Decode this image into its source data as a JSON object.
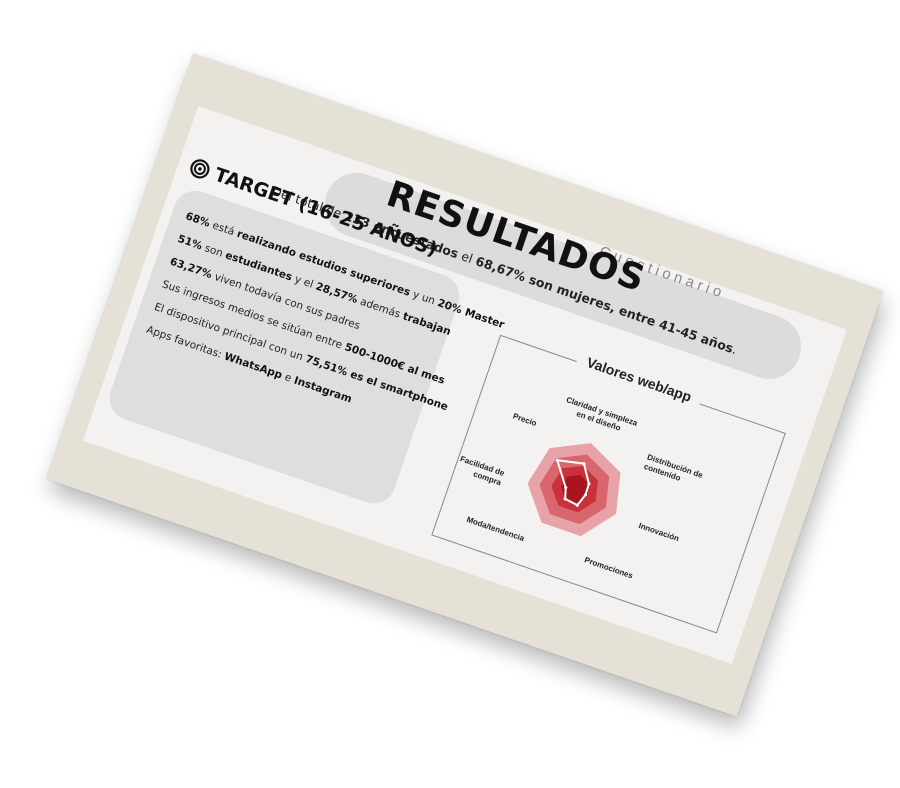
{
  "header": {
    "subtitle": "Cuestionario",
    "title": "RESULTADOS",
    "summary": {
      "t1": "Del total de ",
      "b1": "233 encuestados",
      "t2": " el ",
      "b2": "68,67% son mujeres, entre 41-45 años",
      "t3": "."
    }
  },
  "target": {
    "heading": "TARGET (16-25 AÑOS)",
    "icon": "target-icon",
    "items": [
      {
        "b1": "68%",
        "t1": " está ",
        "b2": "realizando estudios superiores",
        "t2": " y un ",
        "b3": "20% Master",
        "t3": ""
      },
      {
        "b1": "51%",
        "t1": " son ",
        "b2": "estudiantes",
        "t2": " y el ",
        "b3": "28,57%",
        "t3": " además ",
        "b4": "trabajan"
      },
      {
        "b1": "63,27%",
        "t1": " viven todavía con sus padres"
      },
      {
        "t1": "Sus ingresos medios se sitúan entre ",
        "b1": "500-1000€ al mes"
      },
      {
        "t1": "El dispositivo principal con un ",
        "b1": "75,51% es el smartphone"
      },
      {
        "t1": "Apps favoritas: ",
        "b1": "WhatsApp",
        "t2": " e ",
        "b2": "Instagram"
      }
    ]
  },
  "chart_data": {
    "type": "radar",
    "title": "Valores web/app",
    "categories": [
      "Claridad y simpleza en el diseño",
      "Distribución de contenido",
      "Innovación",
      "Promociones",
      "Moda/tendencia",
      "Facilidad de compra",
      "Precio"
    ],
    "category_lines": [
      [
        "Claridad y simpleza",
        "en el diseño"
      ],
      [
        "Distribución de",
        "contenido"
      ],
      [
        "Innovación"
      ],
      [
        "Promociones"
      ],
      [
        "Moda/tendencia"
      ],
      [
        "Facilidad de",
        "compra"
      ],
      [
        "Precio"
      ]
    ],
    "bands": [
      1.0,
      0.75,
      0.5,
      0.3
    ],
    "band_colors": [
      "#e8a3a8",
      "#d9656d",
      "#c7323c",
      "#a9141f"
    ],
    "values": [
      0.55,
      0.3,
      0.25,
      0.35,
      0.3,
      0.2,
      0.7
    ],
    "rmax": 1.0,
    "series_line_color": "#ffffff"
  }
}
